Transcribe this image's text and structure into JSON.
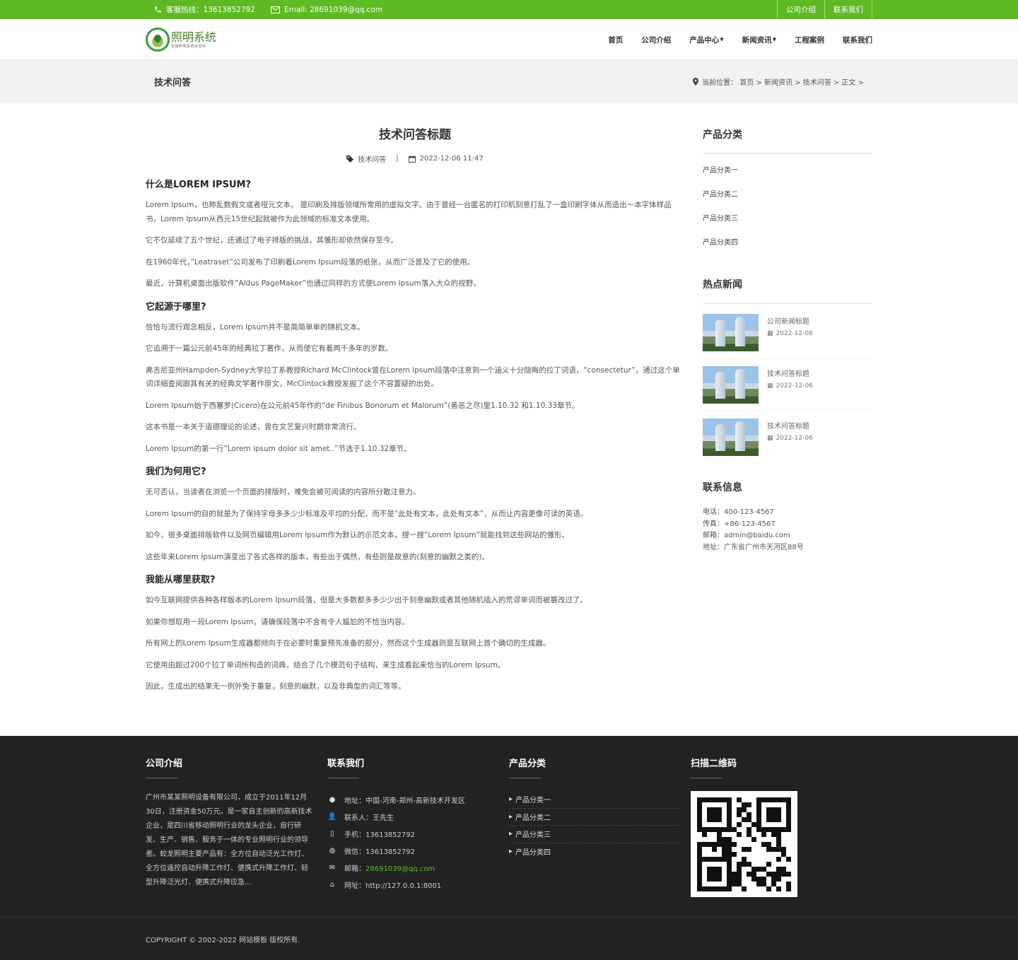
{
  "topbar": {
    "hotline": "客服热线：13613852792",
    "email": "Email: 28691039@qq.com",
    "links": [
      "公司介绍",
      "联系我们"
    ]
  },
  "header": {
    "logo_title": "照明系统",
    "logo_sub": "无锡照明系统供应商",
    "nav": [
      "首页",
      "公司介绍",
      "产品中心",
      "新闻资讯",
      "工程案例",
      "联系我们"
    ]
  },
  "banner": {
    "title": "技术问答",
    "crumb": "当前位置： 首页 > 新闻资讯 > 技术问答 > 正文 >"
  },
  "article": {
    "title": "技术问答标题",
    "category": "技术问答",
    "date": "2022-12-06 11:47",
    "blocks": [
      {
        "h": "什么是LOREM IPSUM?"
      },
      {
        "p": "Lorem Ipsum，也称乱数假文或者哑元文本， 是印刷及排版领域所常用的虚拟文字。由于曾经一台匿名的打印机刻意打乱了一盒印刷字体从而造出一本字体样品书，Lorem Ipsum从西元15世纪起就被作为此领域的标准文本使用。"
      },
      {
        "p": "它不仅延续了五个世纪，还通过了电子排版的挑战，其雏形却依然保存至今。"
      },
      {
        "p": "在1960年代，”Leatraset”公司发布了印刷着Lorem Ipsum段落的纸张，从而广泛普及了它的使用。"
      },
      {
        "p": "最近，计算机桌面出版软件”Aldus PageMaker”也通过同样的方式使Lorem Ipsum落入大众的视野。"
      },
      {
        "h": "它起源于哪里?"
      },
      {
        "p": "恰恰与流行观念相反，Lorem Ipsum并不是简简单单的随机文本。"
      },
      {
        "p": "它追溯于一篇公元前45年的经典拉丁著作，从而使它有着两千多年的岁数。"
      },
      {
        "p": "弗吉尼亚州Hampden-Sydney大学拉丁系教授Richard McClintock曾在Lorem Ipsum段落中注意到一个涵义十分隐晦的拉丁词语，“consectetur”，通过这个单词详细查阅跟其有关的经典文学著作原文，McClintock教授发掘了这个不容置疑的出处。"
      },
      {
        "p": "Lorem Ipsum始于西塞罗(Cicero)在公元前45年作的“de Finibus Bonorum et Malorum”(善恶之尽)里1.10.32 和1.10.33章节。"
      },
      {
        "p": "这本书是一本关于道德理论的论述，曾在文艺复兴时期非常流行。"
      },
      {
        "p": "Lorem Ipsum的第一行”Lorem ipsum dolor sit amet..”节选于1.10.32章节。"
      },
      {
        "h": "我们为何用它?"
      },
      {
        "p": "无可否认，当读者在浏览一个页面的排版时，难免会被可阅读的内容所分散注意力。"
      },
      {
        "p": "Lorem Ipsum的目的就是为了保持字母多多少少标准及平均的分配，而不是“此处有文本，此处有文本”，从而让内容更像可读的英语。"
      },
      {
        "p": "如今，很多桌面排版软件以及网页编辑用Lorem Ipsum作为默认的示范文本，搜一搜“Lorem Ipsum”就能找到这些网站的雏形。"
      },
      {
        "p": "这些年来Lorem Ipsum演变出了各式各样的版本，有些出于偶然，有些则是故意的(刻意的幽默之类的)。"
      },
      {
        "h": "我能从哪里获取?"
      },
      {
        "p": "如今互联网提供各种各样版本的Lorem Ipsum段落，但是大多数都多多少少出于刻意幽默或者其他随机插入的荒谬单词而被篡改过了。"
      },
      {
        "p": "如果你想取用一段Lorem Ipsum，请确保段落中不含有令人尴尬的不恰当内容。"
      },
      {
        "p": "所有网上的Lorem Ipsum生成器都倾向于在必要时重复预先准备的部分，然而这个生成器则是互联网上首个确切的生成器。"
      },
      {
        "p": "它使用由超过200个拉丁单词所构造的词典，结合了几个模范句子结构，来生成看起来恰当的Lorem Ipsum。"
      },
      {
        "p": "因此，生成出的结果无一例外免于重复，刻意的幽默，以及非典型的词汇等等。"
      }
    ]
  },
  "sidebar": {
    "cat_title": "产品分类",
    "categories": [
      "产品分类一",
      "产品分类二",
      "产品分类三",
      "产品分类四"
    ],
    "news_title": "热点新闻",
    "news": [
      {
        "title": "公司新闻标题",
        "date": "2022-12-06"
      },
      {
        "title": "技术问答标题",
        "date": "2022-12-06"
      },
      {
        "title": "技术问答标题",
        "date": "2022-12-06"
      }
    ],
    "contact_title": "联系信息",
    "contact": [
      "电话：400-123-4567",
      "传真：+86-123-4567",
      "邮箱：admin@baidu.com",
      "地址：广东省广州市天河区88号"
    ]
  },
  "footer": {
    "about_title": "公司介绍",
    "about": "广州市某某照明设备有限公司，成立于2011年12月30日，注册资金50万元。是一家自主创新的高新技术企业，是四川省移动照明行业的龙头企业，自行研发、生产、销售、服务于一体的专业照明行业的领导者。蛟龙照明主要产品有：全方位自动泛光工作灯、全方位遥控自动升降工作灯、便携式升降工作灯、轻型升降泛光灯、便携式升降应急...",
    "contact_title": "联系我们",
    "contact": {
      "address": "地址：中国-河南-郑州-高新技术开发区",
      "person": "联系人：王先生",
      "mobile": "手机：13613852792",
      "wechat": "微信：13613852792",
      "email_label": "邮箱：",
      "email": "28691039@qq.com",
      "site": "网址：http://127.0.0.1:8001"
    },
    "cat_title": "产品分类",
    "categories": [
      "产品分类一",
      "产品分类二",
      "产品分类三",
      "产品分类四"
    ],
    "qr_title": "扫描二维码",
    "copyright": "COPYRIGHT © 2002-2022 网站模板 版权所有."
  },
  "colors": {
    "accent": "#5fb923",
    "footer_bg": "#222222",
    "banner_bg": "#f2f2f2"
  }
}
